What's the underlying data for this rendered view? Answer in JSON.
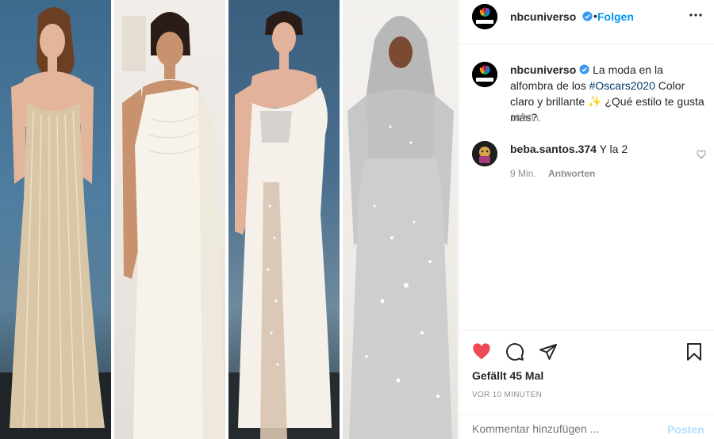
{
  "header": {
    "username": "nbcuniverso",
    "separator": "•",
    "follow_label": "Folgen"
  },
  "caption": {
    "username": "nbcuniverso",
    "text_before": "La moda en la alfombra de los ",
    "hashtag": "#Oscars2020",
    "text_after": " Color claro y brillante ✨ ¿Qué estilo te gusta más?",
    "time": "10 Min."
  },
  "comments": [
    {
      "username": "beba.santos.374",
      "text": "Y la 2",
      "time": "9 Min.",
      "reply_label": "Antworten"
    }
  ],
  "actions": {
    "likes": "Gefällt 45 Mal",
    "post_time": "VOR 10 MINUTEN"
  },
  "comment_box": {
    "placeholder": "Kommentar hinzufügen ...",
    "post_label": "Posten"
  },
  "icons": {
    "heart": "heart-filled-icon",
    "comment": "comment-icon",
    "share": "share-icon",
    "bookmark": "bookmark-icon",
    "more": "more-options-icon",
    "verified": "verified-badge-icon"
  },
  "colors": {
    "accent": "#0095f6",
    "like": "#ed4956",
    "muted": "#8e8e8e",
    "post_disabled": "#b2dffc",
    "hashtag": "#00376b"
  }
}
